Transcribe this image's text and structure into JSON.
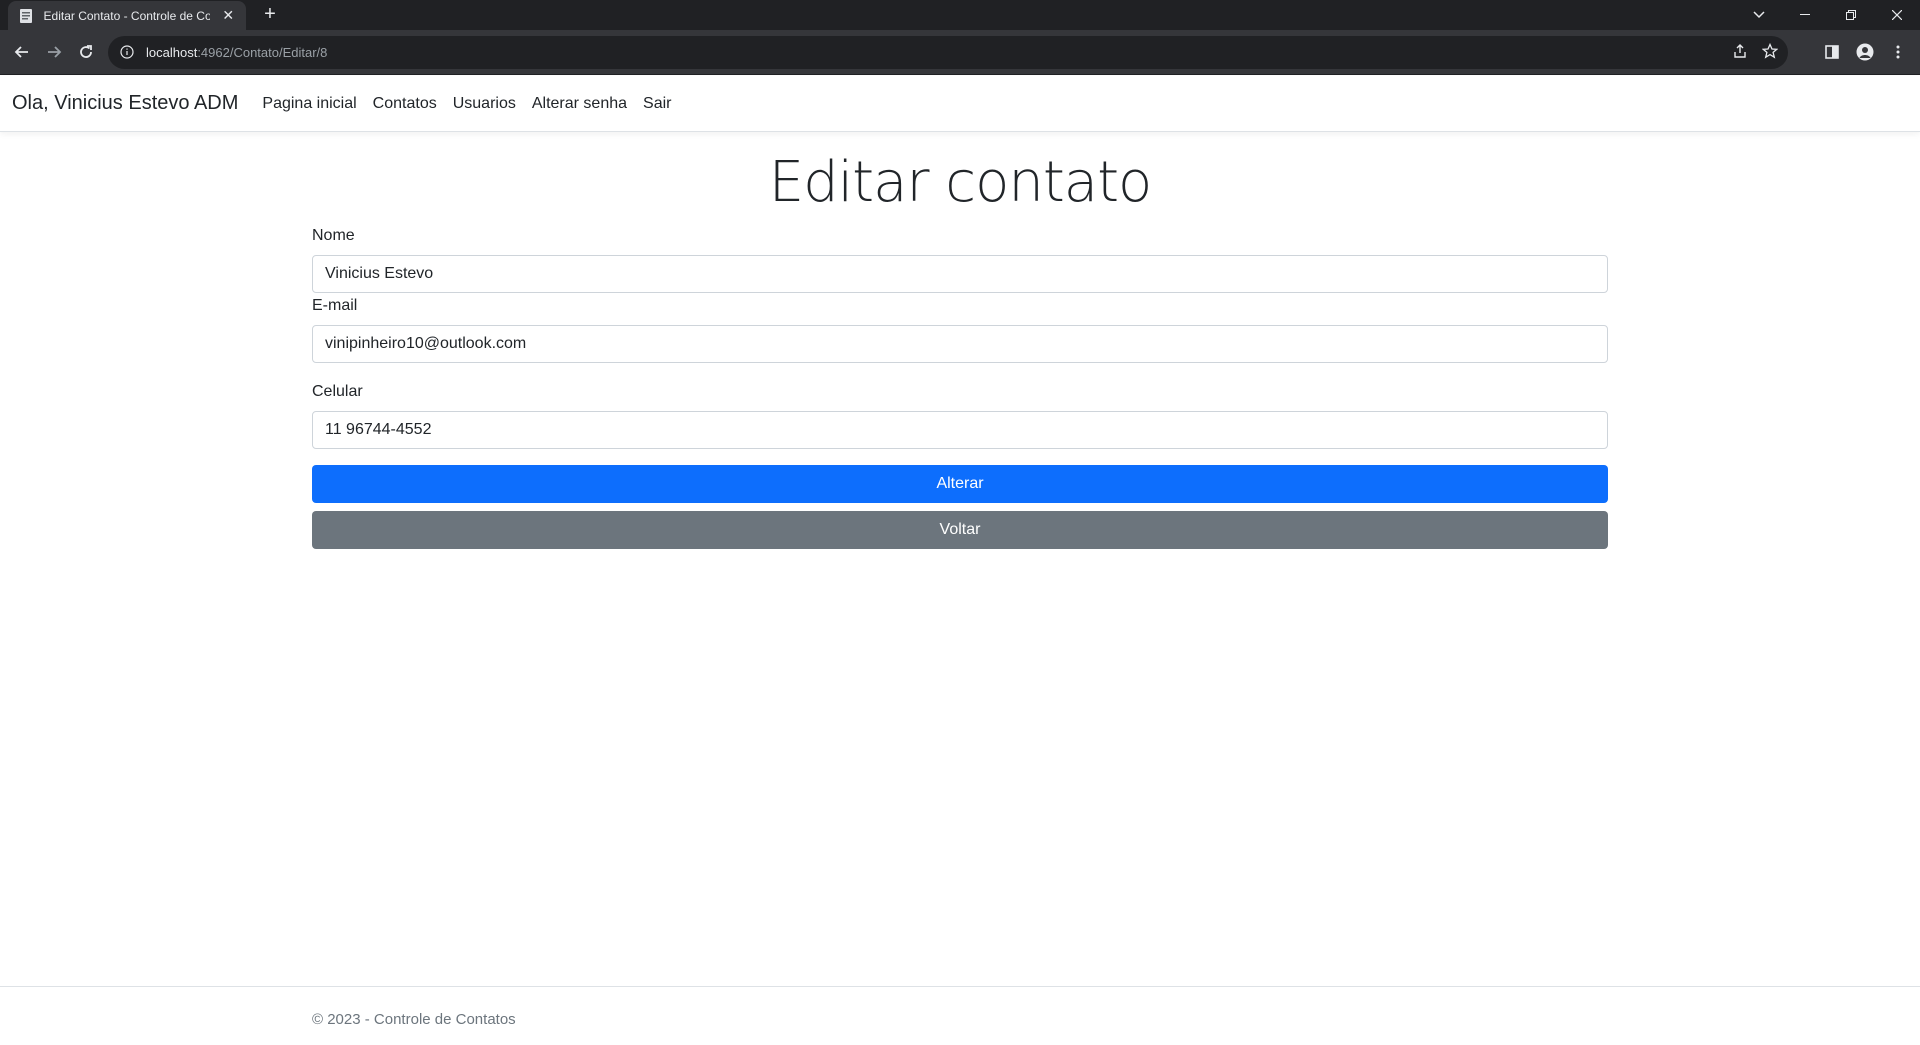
{
  "browser": {
    "tab_title": "Editar Contato - Controle de Contatos",
    "url_host": "localhost",
    "url_path": ":4962/Contato/Editar/8"
  },
  "navbar": {
    "brand": "Ola, Vinicius Estevo ADM",
    "links": [
      "Pagina inicial",
      "Contatos",
      "Usuarios",
      "Alterar senha",
      "Sair"
    ]
  },
  "page": {
    "title": "Editar contato"
  },
  "form": {
    "nome_label": "Nome",
    "nome_value": "Vinicius Estevo",
    "email_label": "E-mail",
    "email_value": "vinipinheiro10@outlook.com",
    "celular_label": "Celular",
    "celular_value": "11 96744-4552",
    "alterar_label": "Alterar",
    "voltar_label": "Voltar"
  },
  "footer": {
    "text": "© 2023 - Controle de Contatos"
  },
  "colors": {
    "primary": "#0d6efd",
    "secondary": "#6c757d",
    "chrome_dark": "#202124",
    "chrome_toolbar": "#35363a"
  }
}
